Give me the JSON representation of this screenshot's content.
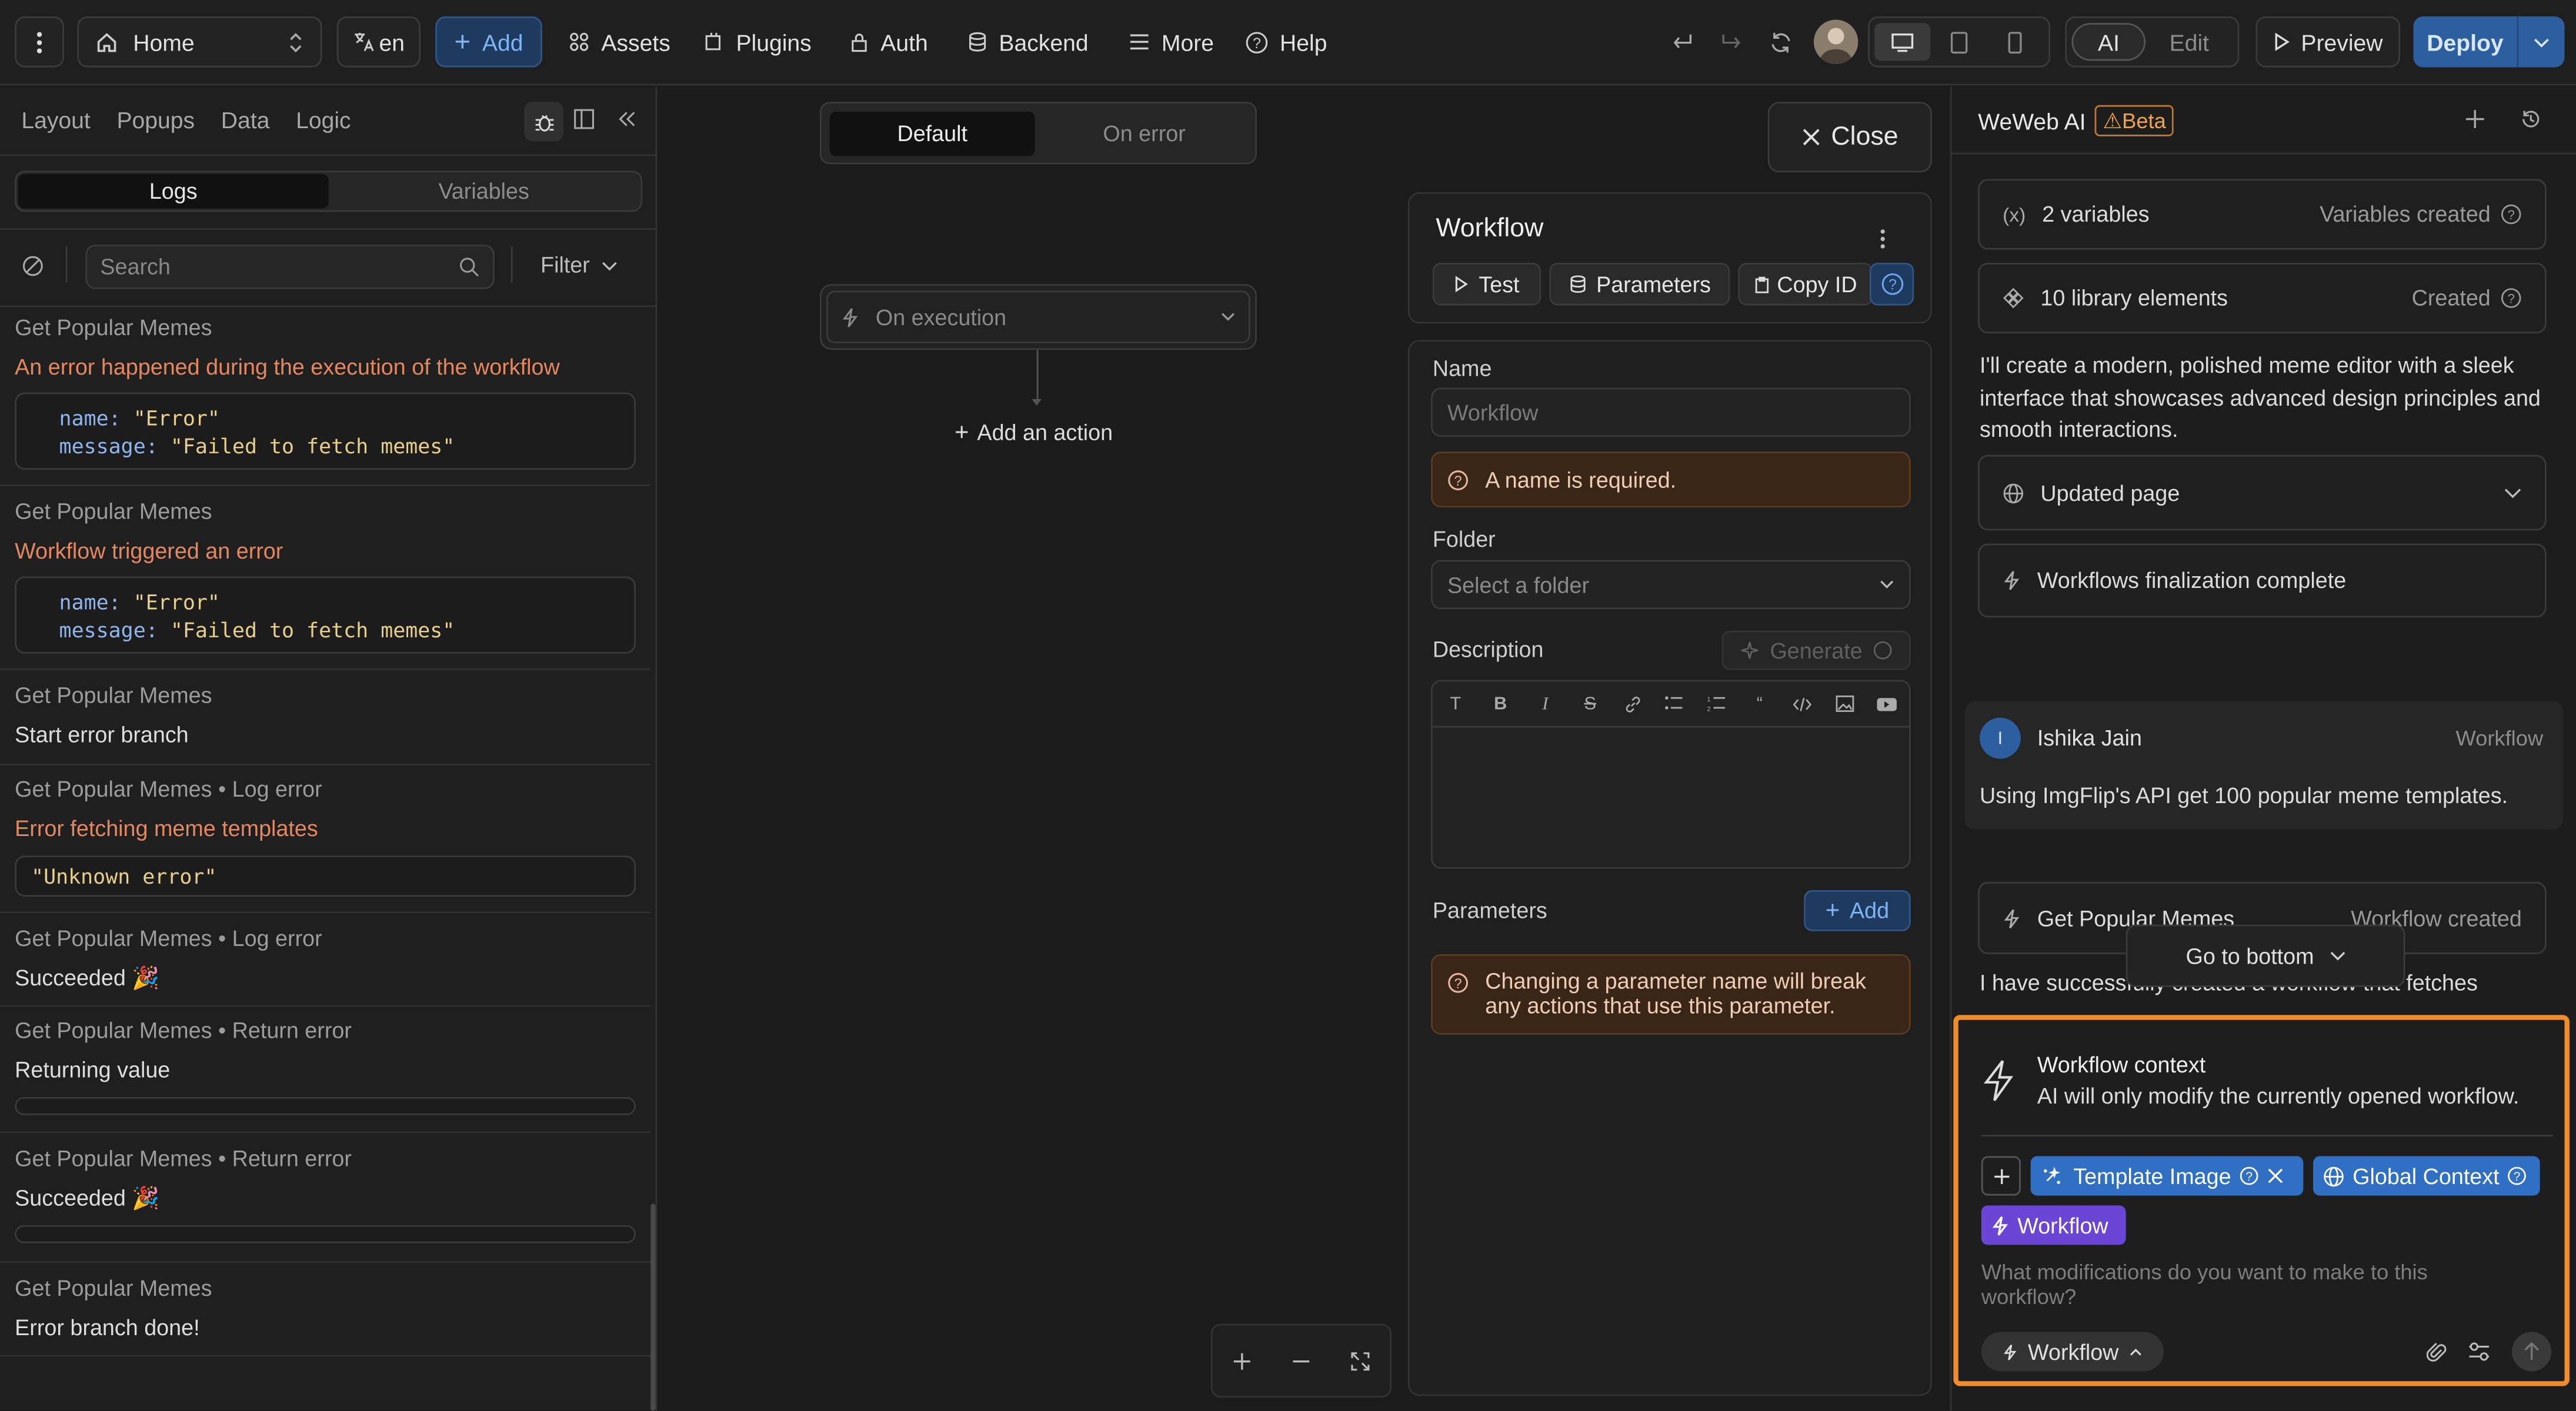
{
  "topbar": {
    "page_select": "Home",
    "language": "en",
    "add_label": "Add",
    "menu": [
      "Assets",
      "Plugins",
      "Auth",
      "Backend",
      "More",
      "Help"
    ],
    "mode_ai": "AI",
    "mode_edit": "Edit",
    "preview_label": "Preview",
    "deploy_label": "Deploy"
  },
  "left": {
    "tabs": [
      "Layout",
      "Popups",
      "Data",
      "Logic"
    ],
    "subtabs": [
      "Logs",
      "Variables"
    ],
    "search_placeholder": "Search",
    "filter_label": "Filter",
    "logs": [
      {
        "source": "Get Popular Memes",
        "message": "An error happened during the execution of the workflow",
        "status": "error",
        "code": {
          "name": "\"Error\"",
          "message": "\"Failed to fetch memes\""
        }
      },
      {
        "source": "Get Popular Memes",
        "message": "Workflow triggered an error",
        "status": "error",
        "code": {
          "name": "\"Error\"",
          "message": "\"Failed to fetch memes\""
        }
      },
      {
        "source": "Get Popular Memes",
        "message": "Start error branch",
        "status": "info"
      },
      {
        "source": "Get Popular Memes • Log error",
        "message": "Error fetching meme templates",
        "status": "error",
        "value": "\"Unknown error\""
      },
      {
        "source": "Get Popular Memes • Log error",
        "message": "Succeeded 🎉",
        "status": "info"
      },
      {
        "source": "Get Popular Memes • Return error",
        "message": "Returning value",
        "status": "info"
      },
      {
        "source": "Get Popular Memes • Return error",
        "message": "Succeeded 🎉",
        "status": "info"
      },
      {
        "source": "Get Popular Memes",
        "message": "Error branch done!",
        "status": "info"
      }
    ],
    "code_keys": {
      "name": "name:",
      "message": "message:"
    }
  },
  "canvas": {
    "tabs": [
      "Default",
      "On error"
    ],
    "trigger": "On execution",
    "add_action": "Add an action",
    "close_label": "Close"
  },
  "workflow": {
    "title": "Workflow",
    "test_label": "Test",
    "parameters_label": "Parameters",
    "copy_id_label": "Copy ID",
    "name_label": "Name",
    "name_placeholder": "Workflow",
    "name_error": "A name is required.",
    "folder_label": "Folder",
    "folder_placeholder": "Select a folder",
    "description_label": "Description",
    "generate_label": "Generate",
    "parameters_section_label": "Parameters",
    "add_param_label": "Add",
    "param_warning": "Changing a parameter name will break any actions that use this parameter."
  },
  "ai": {
    "title": "WeWeb AI",
    "beta": "⚠Beta",
    "variables_card": {
      "label": "2 variables",
      "status": "Variables created"
    },
    "library_card": {
      "label": "10 library elements",
      "status": "Created"
    },
    "message_1": "I'll create a modern, polished meme editor with a sleek interface that showcases advanced design principles and smooth interactions.",
    "updated_page": "Updated page",
    "workflows_final": "Workflows finalization complete",
    "user": {
      "initial": "I",
      "name": "Ishika Jain",
      "tag": "Workflow",
      "message": "Using ImgFlip's API get 100 popular meme templates."
    },
    "workflow_card": {
      "label": "Get Popular Memes",
      "status": "Workflow created"
    },
    "go_to_bottom": "Go to bottom",
    "message_2": "I have successfully created a workflow that fetches",
    "context_title": "Workflow context",
    "context_desc": "AI will only modify the currently opened workflow.",
    "chips": [
      "Template Image",
      "Global Context",
      "Workflow"
    ],
    "input_placeholder": "What modifications do you want to make to this workflow?",
    "mode_label": "Workflow"
  },
  "colors": {
    "accent": "#3b82f6",
    "highlight": "#f08c2a",
    "purple": "#6a45d6",
    "error": "#e5885e"
  }
}
